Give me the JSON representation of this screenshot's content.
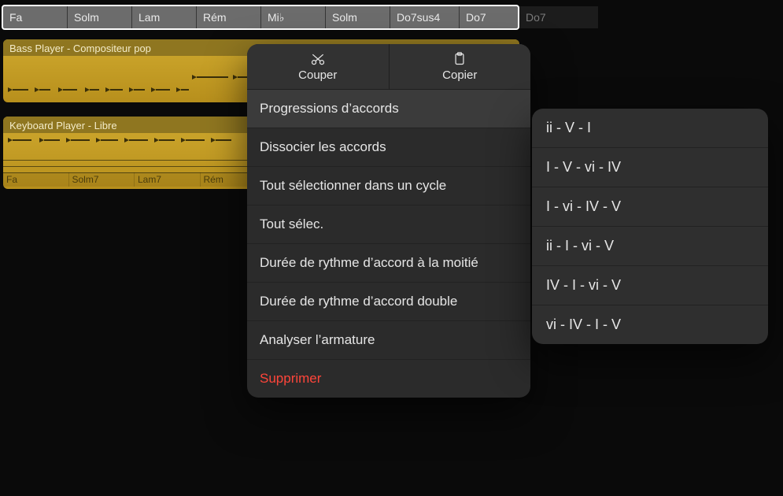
{
  "chord_strip": {
    "selected": [
      "Fa",
      "Solm",
      "Lam",
      "Rém",
      "Mi♭",
      "Solm",
      "Do7sus4",
      "Do7"
    ],
    "trailing": [
      "Do7"
    ]
  },
  "regions": [
    {
      "title": "Bass Player - Compositeur pop",
      "mini_chords": []
    },
    {
      "title": "Keyboard Player - Libre",
      "mini_chords": [
        "Fa",
        "Solm7",
        "Lam7",
        "Rém"
      ]
    }
  ],
  "menu": {
    "top": {
      "cut": {
        "label": "Couper",
        "icon": "scissors-icon"
      },
      "copy": {
        "label": "Copier",
        "icon": "clipboard-icon"
      }
    },
    "items": [
      {
        "label": "Progressions d’accords",
        "highlight": true
      },
      {
        "label": "Dissocier les accords"
      },
      {
        "label": "Tout sélectionner dans un cycle"
      },
      {
        "label": "Tout sélec."
      },
      {
        "label": "Durée de rythme d’accord à la moitié"
      },
      {
        "label": "Durée de rythme d’accord double"
      },
      {
        "label": "Analyser l’armature"
      },
      {
        "label": "Supprimer",
        "danger": true
      }
    ]
  },
  "submenu": {
    "items": [
      "ii - V - I",
      "I - V - vi - IV",
      "I - vi - IV - V",
      "ii - I - vi - V",
      "IV - I - vi - V",
      "vi - IV - I - V"
    ]
  }
}
